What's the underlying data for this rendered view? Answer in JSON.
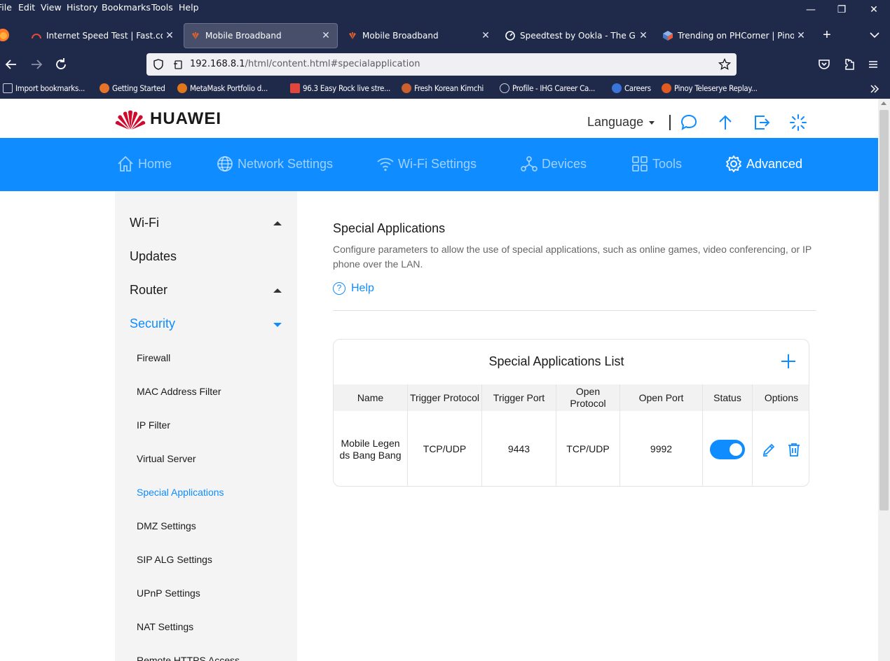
{
  "browser": {
    "menu": [
      "File",
      "Edit",
      "View",
      "History",
      "Bookmarks",
      "Tools",
      "Help"
    ],
    "tabs": [
      {
        "label": "Internet Speed Test | Fast.com",
        "active": false
      },
      {
        "label": "Mobile Broadband",
        "active": true
      },
      {
        "label": "Mobile Broadband",
        "active": false
      },
      {
        "label": "Speedtest by Ookla - The Global",
        "active": false
      },
      {
        "label": "Trending on PHCorner | Pinoy In",
        "active": false
      }
    ],
    "url_host": "192.168.8.1",
    "url_path": "/html/content.html#specialapplication",
    "bookmarks": [
      {
        "label": "Import bookmarks...",
        "color": "#cfd3de"
      },
      {
        "label": "Getting Started",
        "color": "#e8742a"
      },
      {
        "label": "MetaMask Portfolio d...",
        "color": "#e2761b"
      },
      {
        "label": "96.3 Easy Rock live stre...",
        "color": "#e0463c"
      },
      {
        "label": "Fresh Korean Kimchi",
        "color": "#c9602d"
      },
      {
        "label": "Profile - IHG Career Ca...",
        "color": "#cfd3de"
      },
      {
        "label": "Careers",
        "color": "#3a74d8"
      },
      {
        "label": "Pinoy Teleserye Replay...",
        "color": "#e05a22"
      }
    ]
  },
  "header": {
    "brand": "HUAWEI",
    "language_label": "Language",
    "brand_color": "#cf0a2c"
  },
  "mainnav": [
    {
      "label": "Home",
      "icon": "home-icon",
      "active": false
    },
    {
      "label": "Network Settings",
      "icon": "globe-icon",
      "active": false
    },
    {
      "label": "Wi-Fi Settings",
      "icon": "wifi-icon",
      "active": false
    },
    {
      "label": "Devices",
      "icon": "devices-icon",
      "active": false
    },
    {
      "label": "Tools",
      "icon": "tools-icon",
      "active": false
    },
    {
      "label": "Advanced",
      "icon": "gear-icon",
      "active": true
    }
  ],
  "sidebar": {
    "groups": [
      {
        "label": "Wi-Fi",
        "caret": "up",
        "active": false
      },
      {
        "label": "Updates",
        "caret": "",
        "active": false
      },
      {
        "label": "Router",
        "caret": "up",
        "active": false
      },
      {
        "label": "Security",
        "caret": "down",
        "active": true
      }
    ],
    "items": [
      {
        "label": "Firewall",
        "active": false
      },
      {
        "label": "MAC Address Filter",
        "active": false
      },
      {
        "label": "IP Filter",
        "active": false
      },
      {
        "label": "Virtual Server",
        "active": false
      },
      {
        "label": "Special Applications",
        "active": true
      },
      {
        "label": "DMZ Settings",
        "active": false
      },
      {
        "label": "SIP ALG Settings",
        "active": false
      },
      {
        "label": "UPnP Settings",
        "active": false
      },
      {
        "label": "NAT Settings",
        "active": false
      },
      {
        "label": "Remote HTTPS Access",
        "active": false
      }
    ]
  },
  "content": {
    "title": "Special Applications",
    "description": "Configure parameters to allow the use of special applications, such as online games, video conferencing, or IP phone over the LAN.",
    "help_label": "Help",
    "list_title": "Special Applications List",
    "columns": [
      "Name",
      "Trigger Protocol",
      "Trigger Port",
      "Open Protocol",
      "Open Port",
      "Status",
      "Options"
    ],
    "rows": [
      {
        "name": "Mobile Legends Bang Bang",
        "trigger_protocol": "TCP/UDP",
        "trigger_port": "9443",
        "open_protocol": "TCP/UDP",
        "open_port": "9992",
        "status_enabled": true
      }
    ]
  },
  "colors": {
    "accent": "#0f8cff",
    "browser_chrome": "#1f2a4a"
  }
}
